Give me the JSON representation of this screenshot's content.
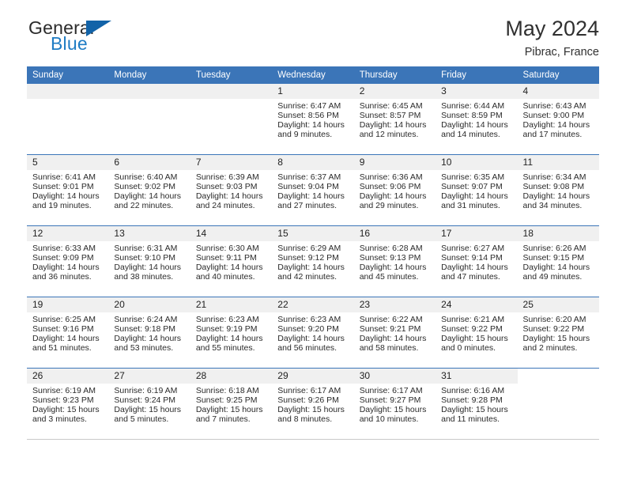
{
  "brand": {
    "name_top": "General",
    "name_bottom": "Blue",
    "triangle_color": "#1263a8",
    "blue_color": "#1f7cc4"
  },
  "header": {
    "title": "May 2024",
    "location": "Pibrac, France"
  },
  "theme": {
    "header_blue": "#3b75b8",
    "daynum_band": "#f0f0f0",
    "text": "#2a2a2a"
  },
  "calendar": {
    "weekday_headers": [
      "Sunday",
      "Monday",
      "Tuesday",
      "Wednesday",
      "Thursday",
      "Friday",
      "Saturday"
    ],
    "weeks": [
      [
        {
          "day": "",
          "sunrise": "",
          "sunset": "",
          "daylight_line1": "",
          "daylight_line2": ""
        },
        {
          "day": "",
          "sunrise": "",
          "sunset": "",
          "daylight_line1": "",
          "daylight_line2": ""
        },
        {
          "day": "",
          "sunrise": "",
          "sunset": "",
          "daylight_line1": "",
          "daylight_line2": ""
        },
        {
          "day": "1",
          "sunrise": "Sunrise: 6:47 AM",
          "sunset": "Sunset: 8:56 PM",
          "daylight_line1": "Daylight: 14 hours",
          "daylight_line2": "and 9 minutes."
        },
        {
          "day": "2",
          "sunrise": "Sunrise: 6:45 AM",
          "sunset": "Sunset: 8:57 PM",
          "daylight_line1": "Daylight: 14 hours",
          "daylight_line2": "and 12 minutes."
        },
        {
          "day": "3",
          "sunrise": "Sunrise: 6:44 AM",
          "sunset": "Sunset: 8:59 PM",
          "daylight_line1": "Daylight: 14 hours",
          "daylight_line2": "and 14 minutes."
        },
        {
          "day": "4",
          "sunrise": "Sunrise: 6:43 AM",
          "sunset": "Sunset: 9:00 PM",
          "daylight_line1": "Daylight: 14 hours",
          "daylight_line2": "and 17 minutes."
        }
      ],
      [
        {
          "day": "5",
          "sunrise": "Sunrise: 6:41 AM",
          "sunset": "Sunset: 9:01 PM",
          "daylight_line1": "Daylight: 14 hours",
          "daylight_line2": "and 19 minutes."
        },
        {
          "day": "6",
          "sunrise": "Sunrise: 6:40 AM",
          "sunset": "Sunset: 9:02 PM",
          "daylight_line1": "Daylight: 14 hours",
          "daylight_line2": "and 22 minutes."
        },
        {
          "day": "7",
          "sunrise": "Sunrise: 6:39 AM",
          "sunset": "Sunset: 9:03 PM",
          "daylight_line1": "Daylight: 14 hours",
          "daylight_line2": "and 24 minutes."
        },
        {
          "day": "8",
          "sunrise": "Sunrise: 6:37 AM",
          "sunset": "Sunset: 9:04 PM",
          "daylight_line1": "Daylight: 14 hours",
          "daylight_line2": "and 27 minutes."
        },
        {
          "day": "9",
          "sunrise": "Sunrise: 6:36 AM",
          "sunset": "Sunset: 9:06 PM",
          "daylight_line1": "Daylight: 14 hours",
          "daylight_line2": "and 29 minutes."
        },
        {
          "day": "10",
          "sunrise": "Sunrise: 6:35 AM",
          "sunset": "Sunset: 9:07 PM",
          "daylight_line1": "Daylight: 14 hours",
          "daylight_line2": "and 31 minutes."
        },
        {
          "day": "11",
          "sunrise": "Sunrise: 6:34 AM",
          "sunset": "Sunset: 9:08 PM",
          "daylight_line1": "Daylight: 14 hours",
          "daylight_line2": "and 34 minutes."
        }
      ],
      [
        {
          "day": "12",
          "sunrise": "Sunrise: 6:33 AM",
          "sunset": "Sunset: 9:09 PM",
          "daylight_line1": "Daylight: 14 hours",
          "daylight_line2": "and 36 minutes."
        },
        {
          "day": "13",
          "sunrise": "Sunrise: 6:31 AM",
          "sunset": "Sunset: 9:10 PM",
          "daylight_line1": "Daylight: 14 hours",
          "daylight_line2": "and 38 minutes."
        },
        {
          "day": "14",
          "sunrise": "Sunrise: 6:30 AM",
          "sunset": "Sunset: 9:11 PM",
          "daylight_line1": "Daylight: 14 hours",
          "daylight_line2": "and 40 minutes."
        },
        {
          "day": "15",
          "sunrise": "Sunrise: 6:29 AM",
          "sunset": "Sunset: 9:12 PM",
          "daylight_line1": "Daylight: 14 hours",
          "daylight_line2": "and 42 minutes."
        },
        {
          "day": "16",
          "sunrise": "Sunrise: 6:28 AM",
          "sunset": "Sunset: 9:13 PM",
          "daylight_line1": "Daylight: 14 hours",
          "daylight_line2": "and 45 minutes."
        },
        {
          "day": "17",
          "sunrise": "Sunrise: 6:27 AM",
          "sunset": "Sunset: 9:14 PM",
          "daylight_line1": "Daylight: 14 hours",
          "daylight_line2": "and 47 minutes."
        },
        {
          "day": "18",
          "sunrise": "Sunrise: 6:26 AM",
          "sunset": "Sunset: 9:15 PM",
          "daylight_line1": "Daylight: 14 hours",
          "daylight_line2": "and 49 minutes."
        }
      ],
      [
        {
          "day": "19",
          "sunrise": "Sunrise: 6:25 AM",
          "sunset": "Sunset: 9:16 PM",
          "daylight_line1": "Daylight: 14 hours",
          "daylight_line2": "and 51 minutes."
        },
        {
          "day": "20",
          "sunrise": "Sunrise: 6:24 AM",
          "sunset": "Sunset: 9:18 PM",
          "daylight_line1": "Daylight: 14 hours",
          "daylight_line2": "and 53 minutes."
        },
        {
          "day": "21",
          "sunrise": "Sunrise: 6:23 AM",
          "sunset": "Sunset: 9:19 PM",
          "daylight_line1": "Daylight: 14 hours",
          "daylight_line2": "and 55 minutes."
        },
        {
          "day": "22",
          "sunrise": "Sunrise: 6:23 AM",
          "sunset": "Sunset: 9:20 PM",
          "daylight_line1": "Daylight: 14 hours",
          "daylight_line2": "and 56 minutes."
        },
        {
          "day": "23",
          "sunrise": "Sunrise: 6:22 AM",
          "sunset": "Sunset: 9:21 PM",
          "daylight_line1": "Daylight: 14 hours",
          "daylight_line2": "and 58 minutes."
        },
        {
          "day": "24",
          "sunrise": "Sunrise: 6:21 AM",
          "sunset": "Sunset: 9:22 PM",
          "daylight_line1": "Daylight: 15 hours",
          "daylight_line2": "and 0 minutes."
        },
        {
          "day": "25",
          "sunrise": "Sunrise: 6:20 AM",
          "sunset": "Sunset: 9:22 PM",
          "daylight_line1": "Daylight: 15 hours",
          "daylight_line2": "and 2 minutes."
        }
      ],
      [
        {
          "day": "26",
          "sunrise": "Sunrise: 6:19 AM",
          "sunset": "Sunset: 9:23 PM",
          "daylight_line1": "Daylight: 15 hours",
          "daylight_line2": "and 3 minutes."
        },
        {
          "day": "27",
          "sunrise": "Sunrise: 6:19 AM",
          "sunset": "Sunset: 9:24 PM",
          "daylight_line1": "Daylight: 15 hours",
          "daylight_line2": "and 5 minutes."
        },
        {
          "day": "28",
          "sunrise": "Sunrise: 6:18 AM",
          "sunset": "Sunset: 9:25 PM",
          "daylight_line1": "Daylight: 15 hours",
          "daylight_line2": "and 7 minutes."
        },
        {
          "day": "29",
          "sunrise": "Sunrise: 6:17 AM",
          "sunset": "Sunset: 9:26 PM",
          "daylight_line1": "Daylight: 15 hours",
          "daylight_line2": "and 8 minutes."
        },
        {
          "day": "30",
          "sunrise": "Sunrise: 6:17 AM",
          "sunset": "Sunset: 9:27 PM",
          "daylight_line1": "Daylight: 15 hours",
          "daylight_line2": "and 10 minutes."
        },
        {
          "day": "31",
          "sunrise": "Sunrise: 6:16 AM",
          "sunset": "Sunset: 9:28 PM",
          "daylight_line1": "Daylight: 15 hours",
          "daylight_line2": "and 11 minutes."
        },
        {
          "day": "",
          "sunrise": "",
          "sunset": "",
          "daylight_line1": "",
          "daylight_line2": ""
        }
      ]
    ]
  }
}
